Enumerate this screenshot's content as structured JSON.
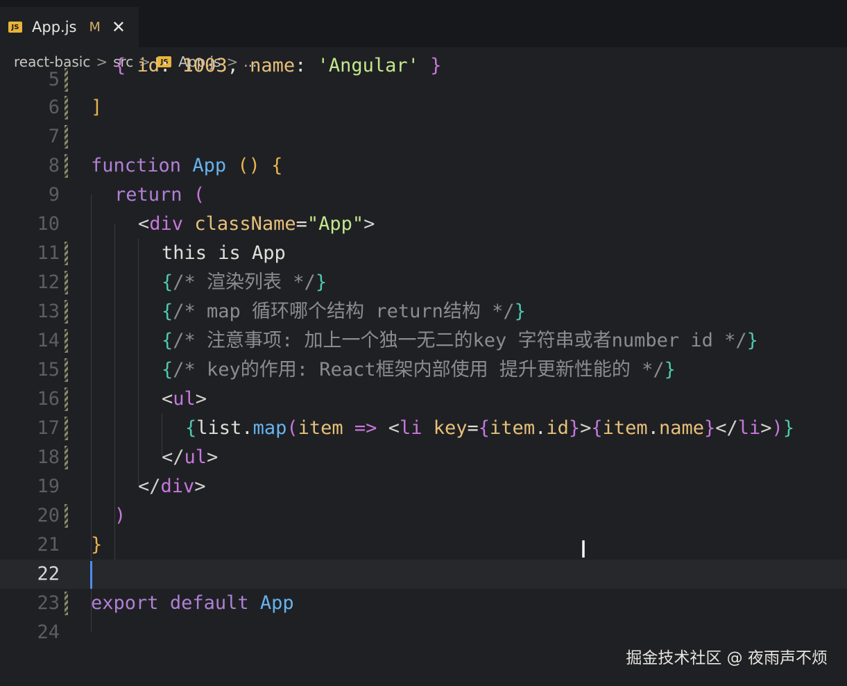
{
  "tab": {
    "badge": "JS",
    "name": "App.js",
    "modified": "M",
    "close": "✕"
  },
  "breadcrumb": {
    "items": [
      "react-basic",
      "src",
      "App.js",
      "..."
    ],
    "sep": ">",
    "badge": "JS"
  },
  "watermark": "掘金技术社区 @ 夜雨声不烦",
  "line_numbers": [
    "5",
    "6",
    "7",
    "8",
    "9",
    "10",
    "11",
    "12",
    "13",
    "14",
    "15",
    "16",
    "17",
    "18",
    "19",
    "20",
    "21",
    "22",
    "23",
    "24"
  ],
  "code": {
    "l5": [
      "{ ",
      "id",
      ": ",
      "1003",
      ", ",
      "name",
      ": ",
      "'Angular'",
      " }"
    ],
    "l6": [
      "]"
    ],
    "l8": [
      "function",
      " ",
      "App",
      " ",
      "()",
      " ",
      "{"
    ],
    "l9": [
      "return",
      " ",
      "("
    ],
    "l10": [
      "<",
      "div",
      " ",
      "className",
      "=",
      "\"App\"",
      ">"
    ],
    "l11": [
      "this is App"
    ],
    "l12": [
      "{",
      "/* 渲染列表 */",
      "}"
    ],
    "l13": [
      "{",
      "/* map 循环哪个结构 return结构 */",
      "}"
    ],
    "l14": [
      "{",
      "/* 注意事项: 加上一个独一无二的key 字符串或者number id */",
      "}"
    ],
    "l15": [
      "{",
      "/* key的作用: React框架内部使用 提升更新性能的 */",
      "}"
    ],
    "l16": [
      "<",
      "ul",
      ">"
    ],
    "l17": [
      "{",
      "list",
      ".",
      "map",
      "(",
      "item",
      " ",
      "=>",
      " ",
      "<",
      "li",
      " ",
      "key",
      "=",
      "{",
      "item",
      ".",
      "id",
      "}",
      ">",
      "{",
      "item",
      ".",
      "name",
      "}",
      "</",
      "li",
      ">",
      ")",
      "}"
    ],
    "l18": [
      "</",
      "ul",
      ">"
    ],
    "l19": [
      "</",
      "div",
      ">"
    ],
    "l20": [
      ")"
    ],
    "l21": [
      "}"
    ],
    "l23": [
      "export",
      " ",
      "default",
      " ",
      "App"
    ]
  }
}
